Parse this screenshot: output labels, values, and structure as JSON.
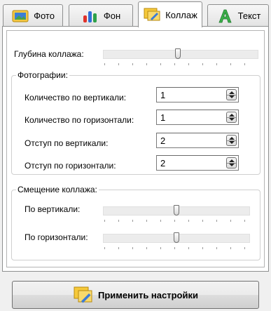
{
  "tabs": [
    {
      "label": "Фото",
      "icon": "photo-icon"
    },
    {
      "label": "Фон",
      "icon": "chart-icon"
    },
    {
      "label": "Коллаж",
      "icon": "collage-icon",
      "active": true
    },
    {
      "label": "Текст",
      "icon": "text-icon"
    }
  ],
  "depth": {
    "label": "Глубина коллажа:",
    "value": 0.48
  },
  "photos": {
    "title": "Фотографии:",
    "fields": [
      {
        "label": "Количество по вертикали:",
        "value": "1"
      },
      {
        "label": "Количество по горизонтали:",
        "value": "1"
      },
      {
        "label": "Отступ по вертикали:",
        "value": "2"
      },
      {
        "label": "Отступ по горизонтали:",
        "value": "2"
      }
    ]
  },
  "offset": {
    "title": "Смещение коллажа:",
    "vertical": {
      "label": "По вертикали:",
      "value": 0.5
    },
    "horizontal": {
      "label": "По горизонтали:",
      "value": 0.5
    }
  },
  "apply_label": "Применить настройки"
}
